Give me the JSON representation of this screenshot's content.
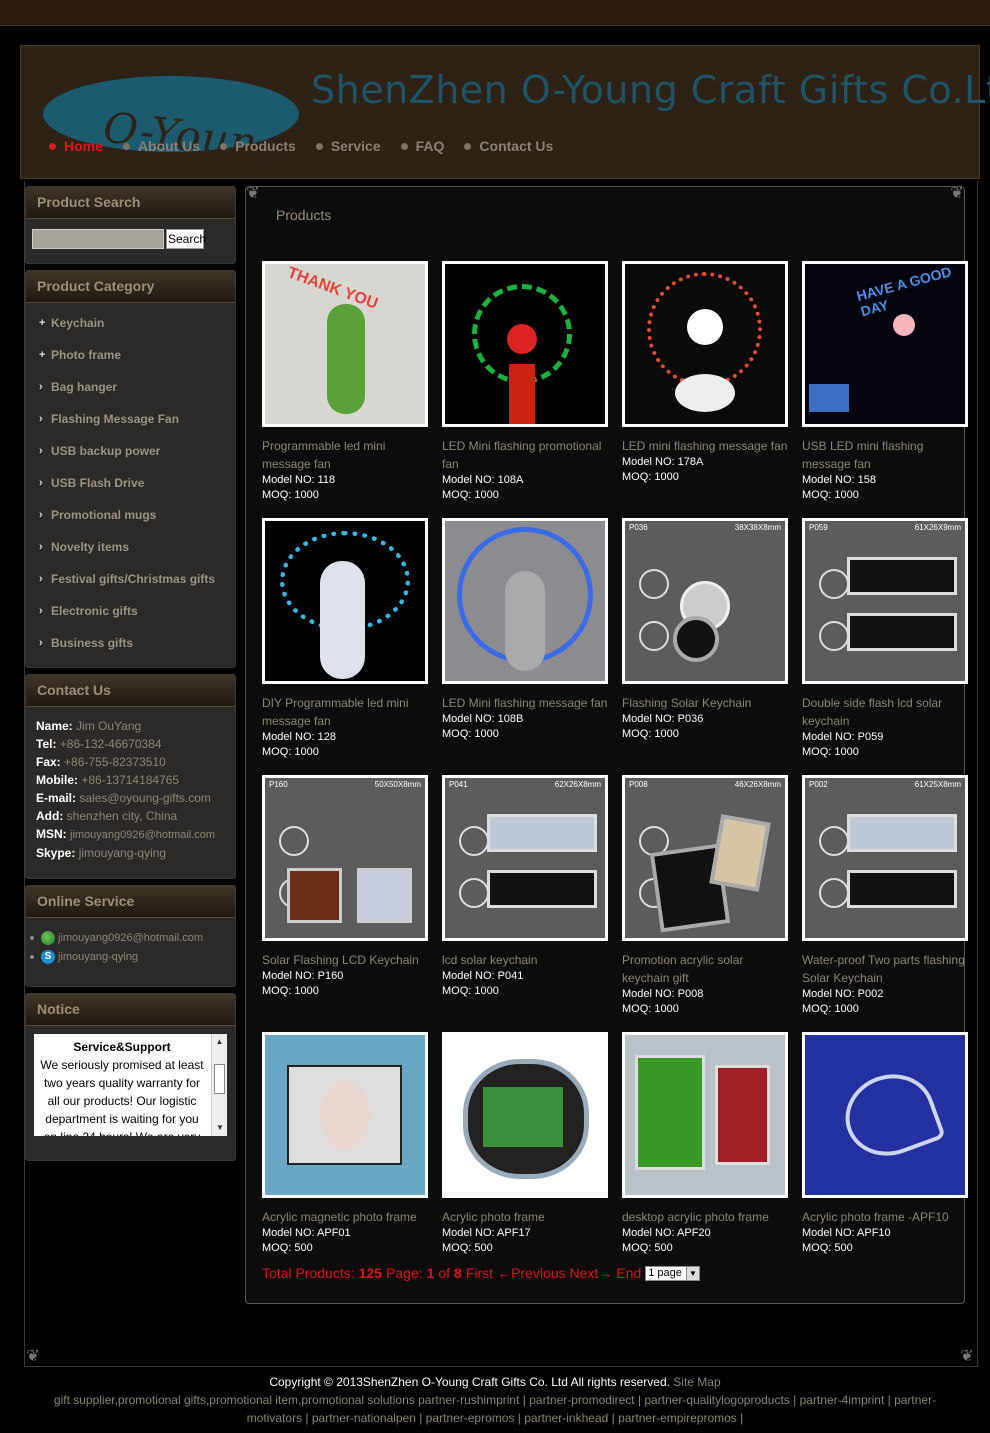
{
  "header": {
    "logo_text": "O-Young",
    "company_name": "ShenZhen O-Young Craft Gifts Co.Ltd",
    "nav": [
      {
        "label": "Home",
        "active": true
      },
      {
        "label": "About Us"
      },
      {
        "label": "Products"
      },
      {
        "label": "Service"
      },
      {
        "label": "FAQ"
      },
      {
        "label": "Contact Us"
      }
    ]
  },
  "search": {
    "title": "Product Search",
    "button": "Search",
    "value": ""
  },
  "category": {
    "title": "Product Category",
    "items": [
      {
        "label": "Keychain",
        "mark": "+"
      },
      {
        "label": "Photo frame",
        "mark": "+"
      },
      {
        "label": "Bag hanger",
        "mark": "›"
      },
      {
        "label": "Flashing Message Fan",
        "mark": "›"
      },
      {
        "label": "USB backup power",
        "mark": "›"
      },
      {
        "label": "USB Flash Drive",
        "mark": "›"
      },
      {
        "label": "Promotional mugs",
        "mark": "›"
      },
      {
        "label": "Novelty items",
        "mark": "›"
      },
      {
        "label": "Festival gifts/Christmas gifts",
        "mark": "›"
      },
      {
        "label": "Electronic gifts",
        "mark": "›"
      },
      {
        "label": "Business gifts",
        "mark": "›"
      }
    ]
  },
  "contact": {
    "title": "Contact Us",
    "rows": [
      {
        "label": "Name:",
        "value": "Jim OuYang"
      },
      {
        "label": "Tel:",
        "value": "+86-132-46670384"
      },
      {
        "label": "Fax:",
        "value": "+86-755-82373510"
      },
      {
        "label": "Mobile:",
        "value": "+86-13714184765"
      },
      {
        "label": "E-mail:",
        "value": "sales@oyoung-gifts.com"
      },
      {
        "label": "Add:",
        "value": "shenzhen city, China"
      },
      {
        "label": "MSN:",
        "value": "jimouyang0926@hotmail.com"
      },
      {
        "label": "Skype:",
        "value": "jimouyang-qying"
      }
    ]
  },
  "online": {
    "title": "Online Service",
    "msn": "jimouyang0926@hotmail.com",
    "skype": "jimouyang-qying"
  },
  "notice": {
    "title": "Notice",
    "heading": "Service&Support",
    "text": "We seriously promised at least two years quality warranty for all our products! Our logistic department is waiting for you on line 24 hours! We are very"
  },
  "main": {
    "title": "Products"
  },
  "products": [
    {
      "name": "Programmable led mini message fan",
      "model": "Model NO: 118",
      "moq": "MOQ: 1000",
      "art": "fan-green",
      "text": "THANK YOU"
    },
    {
      "name": "LED Mini flashing promotional fan",
      "model": "Model NO: 108A",
      "moq": "MOQ: 1000",
      "art": "fan-red"
    },
    {
      "name": "LED mini flashing message fan",
      "model": "Model NO: 178A",
      "moq": "MOQ: 1000",
      "art": "fan-hearts"
    },
    {
      "name": "USB LED mini flashing message fan",
      "model": "Model NO: 158",
      "moq": "MOQ: 1000",
      "art": "fan-usb",
      "text": "HAVE A GOOD DAY"
    },
    {
      "name": "DIY Programmable led mini message fan",
      "model": "Model NO: 128",
      "moq": "MOQ: 1000",
      "art": "fan-diy"
    },
    {
      "name": "LED Mini flashing message fan",
      "model": "Model NO: 108B",
      "moq": "MOQ: 1000",
      "art": "fan-clock"
    },
    {
      "name": "Flashing Solar Keychain",
      "model": "Model NO: P036",
      "moq": "MOQ: 1000",
      "art": "key-round",
      "code": "P036",
      "size": "38X38X8mm"
    },
    {
      "name": "Double side flash lcd solar keychain",
      "model": "Model NO: P059",
      "moq": "MOQ: 1000",
      "art": "key-rect",
      "code": "P059",
      "size": "61X26X9mm"
    },
    {
      "name": "Solar Flashing LCD Keychain",
      "model": "Model NO: P160",
      "moq": "MOQ: 1000",
      "art": "key-square",
      "code": "P160",
      "size": "50X50X8mm"
    },
    {
      "name": "lcd solar keychain",
      "model": "Model NO: P041",
      "moq": "MOQ: 1000",
      "art": "key-rect2",
      "code": "P041",
      "size": "62X26X8mm"
    },
    {
      "name": "Promotion acrylic solar keychain gift",
      "model": "Model NO: P008",
      "moq": "MOQ: 1000",
      "art": "key-tall",
      "code": "P008",
      "size": "46X26X8mm"
    },
    {
      "name": "Water-proof Two parts flashing Solar Keychain",
      "model": "Model NO: P002",
      "moq": "MOQ: 1000",
      "art": "key-rect3",
      "code": "P002",
      "size": "61X25X8mm"
    },
    {
      "name": "Acrylic magnetic photo frame",
      "model": "Model NO: APF01",
      "moq": "MOQ: 500",
      "art": "frame-face"
    },
    {
      "name": "Acrylic photo frame",
      "model": "Model NO: APF17",
      "moq": "MOQ: 500",
      "art": "frame-apple"
    },
    {
      "name": "desktop acrylic photo frame",
      "model": "Model NO: APF20",
      "moq": "MOQ: 500",
      "art": "frame-desk"
    },
    {
      "name": "Acrylic photo frame -APF10",
      "model": "Model NO: APF10",
      "moq": "MOQ: 500",
      "art": "frame-heart"
    }
  ],
  "pager": {
    "total_label": "Total Products:",
    "total": "125",
    "page_label": "Page:",
    "page": "1",
    "of_label": "of",
    "pages": "8",
    "first": "First",
    "prev": "←Previous",
    "next": "Next→",
    "end": "End",
    "select_value": "1 page"
  },
  "footer": {
    "copyright": "Copyright © 2013ShenZhen O-Young Craft Gifts Co. Ltd All rights reserved.",
    "site_map": "Site Map",
    "links": "gift supplier,promotional gifts,promotional item,promotional solutions partner-rushimprint | partner-promodirect | partner-qualitylogoproducts | partner-4imprint | partner-motivators | partner-nationalpen | partner-epromos | partner-inkhead | partner-empirepromos |"
  }
}
